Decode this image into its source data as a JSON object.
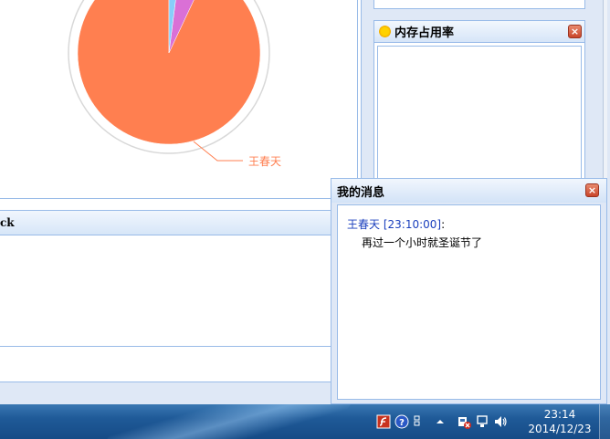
{
  "chart": {
    "slice_label": "王春天"
  },
  "chart_data": {
    "type": "pie",
    "slices": [
      {
        "label": "王春天",
        "share": 0.93,
        "color": "#ff7f50"
      },
      {
        "label": "",
        "share": 0.05,
        "color": "#da70d6"
      },
      {
        "label": "",
        "share": 0.02,
        "color": "#87cefa"
      }
    ]
  },
  "ck_panel": {
    "title": "ck"
  },
  "memory_panel": {
    "title": "内存占用率",
    "close_label": "×"
  },
  "message_window": {
    "title": "我的消息",
    "close_label": "×",
    "messages": [
      {
        "sender": "王春天",
        "time": "[23:10:00]",
        "colon": ":",
        "text": "再过一个小时就圣诞节了"
      }
    ]
  },
  "taskbar": {
    "time": "23:14",
    "date": "2014/12/23",
    "tray_icons": [
      "flash-icon",
      "help-icon",
      "arrow-icon",
      "network-error-icon",
      "monitor-icon",
      "volume-icon"
    ]
  },
  "colors": {
    "panel_border": "#99bbe8",
    "panel_bg": "#dfe8f6",
    "pie_main": "#ff7f50",
    "pie_purple": "#da70d6",
    "pie_blue": "#87cefa",
    "sender": "#1a3fbd",
    "close": "#c9452a"
  }
}
